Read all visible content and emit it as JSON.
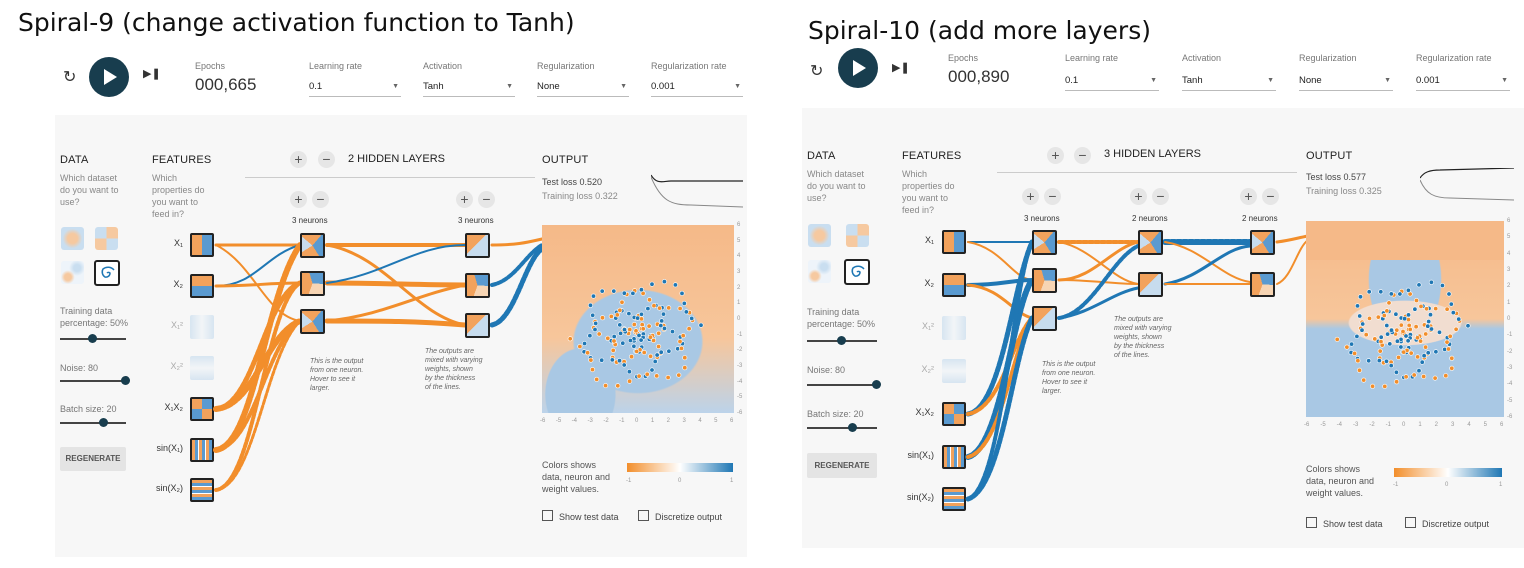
{
  "left": {
    "title": "Spiral-9 (change activation function to Tanh)",
    "epochs_label": "Epochs",
    "epochs_value": "000,665",
    "learning_rate_label": "Learning rate",
    "learning_rate_value": "0.1",
    "activation_label": "Activation",
    "activation_value": "Tanh",
    "regularization_label": "Regularization",
    "regularization_value": "None",
    "reg_rate_label": "Regularization rate",
    "reg_rate_value": "0.001",
    "hidden_layers_label": "2 HIDDEN LAYERS",
    "neuron_counts": [
      "3 neurons",
      "3 neurons"
    ],
    "test_loss": "Test loss 0.520",
    "training_loss": "Training loss 0.322",
    "note_neuron": [
      "This is the output",
      "from one neuron.",
      "Hover to see it",
      "larger."
    ],
    "note_weights": [
      "The outputs are",
      "mixed with varying",
      "weights, shown",
      "by the thickness",
      "of the lines."
    ]
  },
  "right": {
    "title": "Spiral-10 (add more layers)",
    "epochs_label": "Epochs",
    "epochs_value": "000,890",
    "learning_rate_label": "Learning rate",
    "learning_rate_value": "0.1",
    "activation_label": "Activation",
    "activation_value": "Tanh",
    "regularization_label": "Regularization",
    "regularization_value": "None",
    "reg_rate_label": "Regularization rate",
    "reg_rate_value": "0.001",
    "hidden_layers_label": "3 HIDDEN LAYERS",
    "neuron_counts": [
      "3 neurons",
      "2 neurons",
      "2 neurons"
    ],
    "test_loss": "Test loss 0.577",
    "training_loss": "Training loss 0.325",
    "note_neuron": [
      "This is the output",
      "from one neuron.",
      "Hover to see it",
      "larger."
    ],
    "note_weights": [
      "The outputs are",
      "mixed with varying",
      "weights, shown",
      "by the thickness",
      "of the lines."
    ]
  },
  "common": {
    "data_heading": "DATA",
    "data_sub": [
      "Which dataset",
      "do you want to",
      "use?"
    ],
    "features_heading": "FEATURES",
    "features_sub": [
      "Which",
      "properties do",
      "you want to",
      "feed in?"
    ],
    "output_heading": "OUTPUT",
    "training_data_label": "Training data",
    "percentage_label": "percentage:  50%",
    "noise_label": "Noise:  80",
    "batch_label": "Batch size:  20",
    "regenerate": "REGENERATE",
    "features": [
      "X₁",
      "X₂",
      "X₁²",
      "X₂²",
      "X₁X₂",
      "sin(X₁)",
      "sin(X₂)"
    ],
    "colors_legend": [
      "Colors shows",
      "data, neuron and",
      "weight values."
    ],
    "cbar_ticks": [
      "-1",
      "0",
      "1"
    ],
    "show_test_data": "Show test data",
    "discretize_output": "Discretize output",
    "x_ticks": [
      "-6",
      "-5",
      "-4",
      "-3",
      "-2",
      "-1",
      "0",
      "1",
      "2",
      "3",
      "4",
      "5",
      "6"
    ],
    "y_ticks": [
      "6",
      "5",
      "4",
      "3",
      "2",
      "1",
      "0",
      "-1",
      "-2",
      "-3",
      "-4",
      "-5",
      "-6"
    ],
    "colors": {
      "orange": "#f28e2b",
      "blue": "#1f77b4",
      "dark_teal": "#183d4e"
    }
  }
}
